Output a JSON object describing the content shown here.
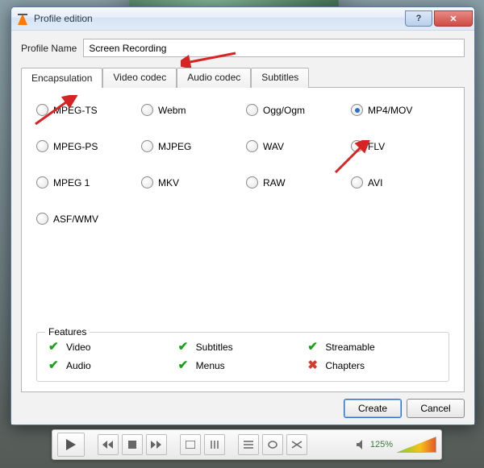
{
  "window": {
    "title": "Profile edition",
    "help_icon": "?",
    "close_icon": "✕"
  },
  "profile": {
    "label": "Profile Name",
    "value": "Screen Recording"
  },
  "tabs": [
    {
      "label": "Encapsulation",
      "active": true
    },
    {
      "label": "Video codec",
      "active": false
    },
    {
      "label": "Audio codec",
      "active": false
    },
    {
      "label": "Subtitles",
      "active": false
    }
  ],
  "encapsulation_options": [
    {
      "label": "MPEG-TS",
      "selected": false
    },
    {
      "label": "Webm",
      "selected": false
    },
    {
      "label": "Ogg/Ogm",
      "selected": false
    },
    {
      "label": "MP4/MOV",
      "selected": true
    },
    {
      "label": "MPEG-PS",
      "selected": false
    },
    {
      "label": "MJPEG",
      "selected": false
    },
    {
      "label": "WAV",
      "selected": false
    },
    {
      "label": "FLV",
      "selected": false
    },
    {
      "label": "MPEG 1",
      "selected": false
    },
    {
      "label": "MKV",
      "selected": false
    },
    {
      "label": "RAW",
      "selected": false
    },
    {
      "label": "AVI",
      "selected": false
    },
    {
      "label": "ASF/WMV",
      "selected": false
    }
  ],
  "features": {
    "title": "Features",
    "items": [
      {
        "label": "Video",
        "supported": true
      },
      {
        "label": "Subtitles",
        "supported": true
      },
      {
        "label": "Streamable",
        "supported": true
      },
      {
        "label": "Audio",
        "supported": true
      },
      {
        "label": "Menus",
        "supported": true
      },
      {
        "label": "Chapters",
        "supported": false
      }
    ]
  },
  "buttons": {
    "create": "Create",
    "cancel": "Cancel"
  },
  "player": {
    "volume_text": "125%"
  },
  "annotation_arrows": [
    "points-to-profile-name",
    "points-to-encapsulation-tab",
    "points-to-mp4-radio"
  ]
}
